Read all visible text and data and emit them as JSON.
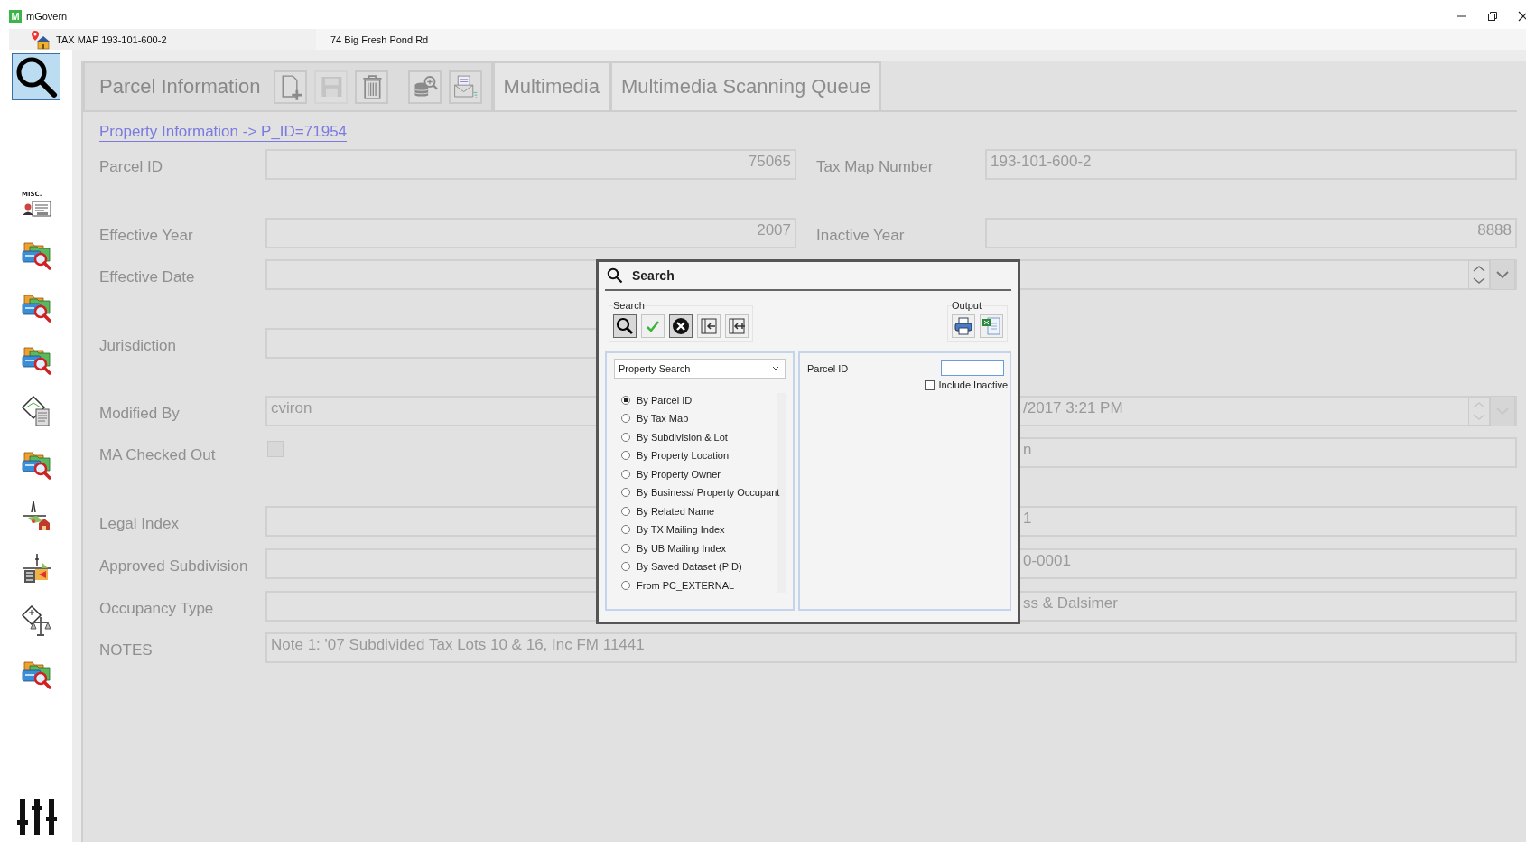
{
  "window": {
    "title": "mGovern",
    "logo": "M"
  },
  "record_bar": {
    "tax_map": "TAX MAP 193-101-600-2",
    "address": "74 Big Fresh Pond Rd"
  },
  "sidebar": {
    "items": [
      {
        "kind": "misc",
        "label": "MISC."
      },
      {
        "kind": "folder-search"
      },
      {
        "kind": "folder-search"
      },
      {
        "kind": "folder-search"
      },
      {
        "kind": "map-doc"
      },
      {
        "kind": "folder-search"
      },
      {
        "kind": "map-house"
      },
      {
        "kind": "map-chart"
      },
      {
        "kind": "map-scale"
      },
      {
        "kind": "folder-search"
      }
    ]
  },
  "tabs": [
    {
      "label": "Parcel Information",
      "selected": true
    },
    {
      "label": "Multimedia",
      "selected": false
    },
    {
      "label": "Multimedia Scanning Queue",
      "selected": false
    }
  ],
  "toolbar": [
    {
      "kind": "new",
      "disabled": false
    },
    {
      "kind": "save",
      "disabled": true
    },
    {
      "kind": "delete",
      "disabled": false
    },
    {
      "kind": "db-search",
      "disabled": false
    },
    {
      "kind": "mail",
      "disabled": false
    }
  ],
  "breadcrumb": "Property Information -> P_ID=71954",
  "form": {
    "rows": [
      {
        "left": {
          "label": "Parcel ID",
          "kind": "number",
          "value": "75065"
        },
        "right": {
          "label": "Tax Map Number",
          "kind": "text",
          "value": "193-101-600-2"
        }
      },
      {
        "left": {
          "label": "Effective Year",
          "kind": "number",
          "value": "2007"
        },
        "right": {
          "label": "Inactive Year",
          "kind": "number",
          "value": "8888"
        }
      },
      {
        "left": {
          "label": "Effective Date",
          "kind": "text"
        },
        "right": {
          "kind": "datetime",
          "disabled": false
        }
      },
      {
        "left": {
          "label": "Jurisdiction",
          "kind": "text"
        }
      },
      {
        "left": {
          "label": "Modified By",
          "kind": "text",
          "value": "cviron"
        },
        "right": {
          "kind": "datetime",
          "value": "/2017 3:21 PM",
          "disabled": true
        }
      },
      {
        "left": {
          "label": "MA Checked Out",
          "kind": "checkbox",
          "checked": false
        },
        "right": {
          "kind": "text",
          "value": "n"
        }
      },
      {
        "left": {
          "label": "Legal Index",
          "kind": "text"
        },
        "right": {
          "kind": "text",
          "value": "1"
        }
      },
      {
        "left": {
          "label": "Approved Subdivision",
          "kind": "text"
        },
        "right": {
          "kind": "text",
          "value": "0-0001"
        }
      },
      {
        "left": {
          "label": "Occupancy Type",
          "kind": "text"
        },
        "right": {
          "kind": "text",
          "value": "ss & Dalsimer"
        }
      },
      {
        "left": {
          "label": "NOTES",
          "kind": "wide",
          "value": "Note 1: '07 Subdivided Tax Lots 10 & 16, Inc FM 11441"
        }
      }
    ]
  },
  "search_dialog": {
    "title": "Search",
    "search_group": {
      "label": "Search",
      "buttons": [
        {
          "kind": "search"
        },
        {
          "kind": "accept"
        },
        {
          "kind": "cancel"
        },
        {
          "kind": "import"
        },
        {
          "kind": "add-import"
        }
      ]
    },
    "output_group": {
      "label": "Output",
      "buttons": [
        {
          "kind": "print"
        },
        {
          "kind": "excel"
        }
      ]
    },
    "search_type": "Property Search",
    "options": [
      {
        "label": "By Parcel ID",
        "selected": true
      },
      {
        "label": "By Tax Map",
        "selected": false
      },
      {
        "label": "By Subdivision & Lot",
        "selected": false
      },
      {
        "label": "By Property Location",
        "selected": false
      },
      {
        "label": "By Property Owner",
        "selected": false
      },
      {
        "label": "By Business/ Property Occupant",
        "selected": false
      },
      {
        "label": "By Related Name",
        "selected": false
      },
      {
        "label": "By TX Mailing Index",
        "selected": false
      },
      {
        "label": "By UB Mailing Index",
        "selected": false
      },
      {
        "label": "By Saved Dataset (P|D)",
        "selected": false
      },
      {
        "label": "From PC_EXTERNAL",
        "selected": false
      }
    ],
    "criteria": {
      "label": "Parcel ID"
    },
    "include_inactive": {
      "label": "Include Inactive",
      "checked": false
    }
  }
}
